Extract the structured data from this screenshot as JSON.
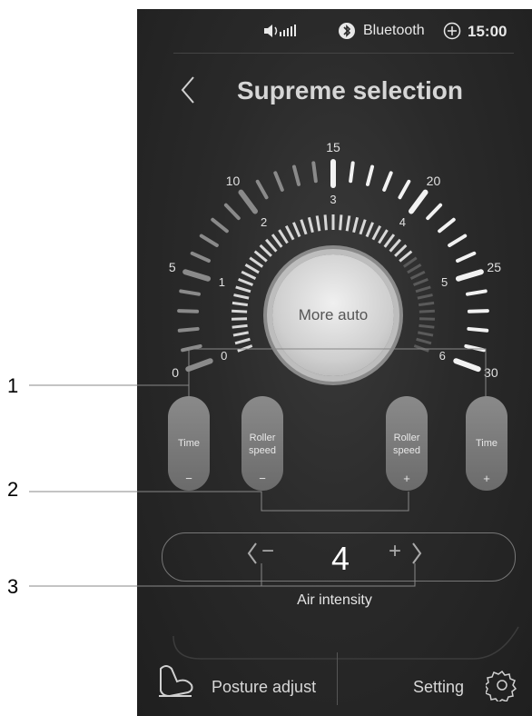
{
  "status_bar": {
    "signal_icon": "speaker-signal-icon",
    "bluetooth_label": "Bluetooth",
    "bluetooth_icon": "bluetooth-icon",
    "plus_icon": "circle-plus-icon",
    "time": "15:00"
  },
  "header": {
    "back_icon": "chevron-left-icon",
    "title": "Supreme selection"
  },
  "dial": {
    "outer_ticks_labels": [
      "0",
      "5",
      "10",
      "15",
      "20",
      "25",
      "30"
    ],
    "inner_ticks_labels": [
      "0",
      "1",
      "2",
      "3",
      "4",
      "5",
      "6"
    ],
    "center_button_label": "More auto"
  },
  "controls": {
    "time_minus": {
      "label": "Time",
      "sign": "−"
    },
    "roller_minus": {
      "label_line1": "Roller",
      "label_line2": "speed",
      "sign": "−"
    },
    "roller_plus": {
      "label_line1": "Roller",
      "label_line2": "speed",
      "sign": "+"
    },
    "time_plus": {
      "label": "Time",
      "sign": "+"
    }
  },
  "air": {
    "value": "4",
    "minus": "−",
    "plus": "+",
    "label": "Air intensity"
  },
  "bottom": {
    "posture_label": "Posture adjust",
    "posture_icon": "seat-icon",
    "setting_label": "Setting",
    "setting_icon": "gear-icon"
  },
  "callouts": [
    "1",
    "2",
    "3"
  ],
  "colors": {
    "background": "#2a2a2a",
    "text": "#d6d6d6",
    "pill": "#7a7a7a"
  }
}
